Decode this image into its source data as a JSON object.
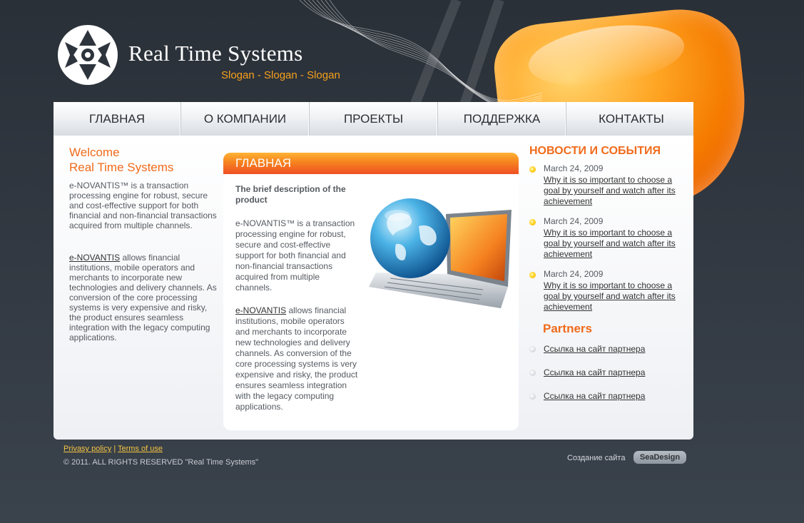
{
  "logo": {
    "title": "Real Time Systems",
    "slogan": "Slogan - Slogan - Slogan"
  },
  "nav": {
    "items": [
      {
        "label": "ГЛАВНАЯ"
      },
      {
        "label": "О КОМПАНИИ"
      },
      {
        "label": "ПРОЕКТЫ"
      },
      {
        "label": "ПОДДЕРЖКА"
      },
      {
        "label": "КОНТАКТЫ"
      }
    ]
  },
  "left": {
    "welcome_line1": "Welcome",
    "welcome_line2": "Real Time Systems",
    "para1": "e-NOVANTIS™ is a transaction processing engine for robust, secure and cost-effective support for both financial and non-financial transactions acquired from multiple channels.",
    "para2_link": "e-NOVANTIS",
    "para2_rest": " allows financial institutions, mobile operators and merchants to incorporate new technologies and delivery channels. As conversion of the core processing systems is very expensive and risky, the product ensures seamless integration with the legacy computing applications."
  },
  "center": {
    "title": "ГЛАВНАЯ",
    "subtitle": "The brief description of the product",
    "para1": "e-NOVANTIS™ is a transaction processing engine for robust, secure and cost-effective support for both financial and non-financial transactions acquired from multiple channels.",
    "para2_link": "e-NOVANTIS",
    "para2_rest": " allows financial institutions, mobile operators and merchants to incorporate new technologies and delivery channels. As conversion of the core processing systems is very expensive and risky, the product ensures seamless integration with the legacy computing applications."
  },
  "news": {
    "title": "НОВОСТИ И СОБЫТИЯ",
    "items": [
      {
        "date": "March 24, 2009",
        "link": "Why it is so important to choose a goal by yourself and watch after its achievement"
      },
      {
        "date": "March 24, 2009",
        "link": "Why it is so important to choose a goal by yourself and watch after its achievement"
      },
      {
        "date": "March 24, 2009",
        "link": "Why it is so important to choose a goal by yourself and watch after its achievement"
      }
    ]
  },
  "partners": {
    "title": "Partners",
    "items": [
      {
        "link": "Ссылка на сайт партнера"
      },
      {
        "link": "Ссылка на сайт партнера"
      },
      {
        "link": "Ссылка на сайт партнера"
      }
    ]
  },
  "footer": {
    "privacy": "Privasy policy",
    "separator": "|",
    "terms": "Terms of use",
    "copyright": "© 2011. ALL RIGHTS RESERVED \"Real Time Systems\"",
    "made_by": "Создание сайта",
    "badge": "SeaDesign"
  },
  "colors": {
    "accent": "#f06b1b",
    "slogan": "#f7a01c",
    "background": "#2e343c"
  }
}
